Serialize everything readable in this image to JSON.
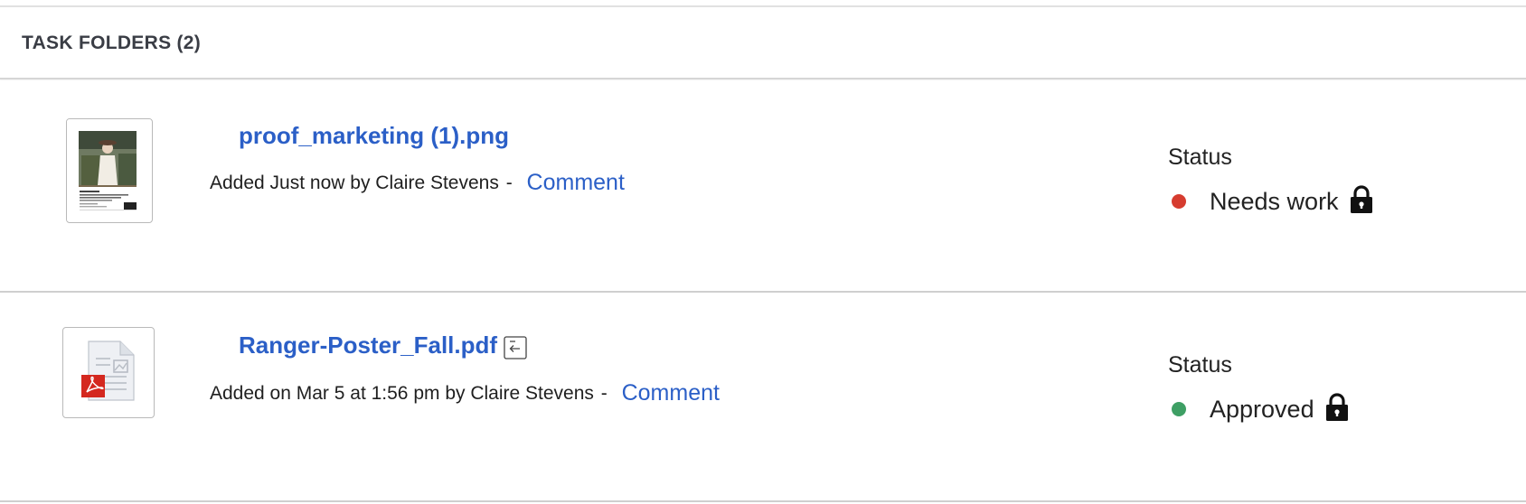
{
  "section": {
    "title": "TASK FOLDERS (2)"
  },
  "files": [
    {
      "name": "proof_marketing (1).png",
      "meta": "Added Just now by Claire Stevens",
      "separator": "-",
      "comment_label": "Comment",
      "status_label": "Status",
      "status": "Needs work",
      "status_color": "#d63c2f",
      "thumbnail_icon": "image-thumbnail"
    },
    {
      "name": "Ranger-Poster_Fall.pdf",
      "meta": "Added on Mar 5 at 1:56 pm by Claire Stevens",
      "separator": "-",
      "comment_label": "Comment",
      "status_label": "Status",
      "status": "Approved",
      "status_color": "#3e9f64",
      "thumbnail_icon": "pdf-file-icon"
    }
  ],
  "colors": {
    "link": "#2b5fc7",
    "header_text": "#3a3d45",
    "divider": "#cfcfcf"
  }
}
